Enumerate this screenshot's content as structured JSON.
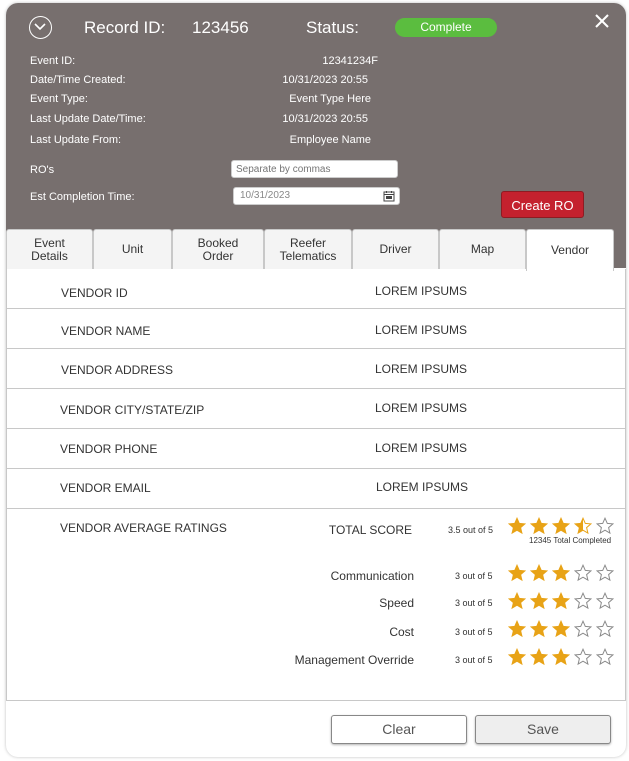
{
  "header": {
    "record_id_label": "Record ID:",
    "record_id_value": "123456",
    "status_label": "Status:",
    "status_value": "Complete",
    "status_color": "#5bbd3f",
    "background_color": "#776f6e"
  },
  "info": {
    "event_id_label": "Event ID:",
    "event_id_value": "12341234F",
    "created_label": "Date/Time Created:",
    "created_value": "10/31/2023 20:55",
    "event_type_label": "Event Type:",
    "event_type_value": "Event Type Here",
    "last_update_label": "Last Update Date/Time:",
    "last_update_value": "10/31/2023 20:55",
    "last_update_from_label": "Last Update From:",
    "last_update_from_value": "Employee Name",
    "ros_label": "RO's",
    "ros_placeholder": "Separate by commas",
    "est_label": "Est Completion Time:",
    "est_value": "10/31/2023",
    "create_ro_label": "Create RO",
    "create_ro_color": "#c4212e"
  },
  "tabs": [
    {
      "label": "Event\nDetails"
    },
    {
      "label": "Unit"
    },
    {
      "label": "Booked\nOrder"
    },
    {
      "label": "Reefer\nTelematics"
    },
    {
      "label": "Driver"
    },
    {
      "label": "Map"
    },
    {
      "label": "Vendor",
      "active": true
    }
  ],
  "vendor": {
    "rows": [
      {
        "label": "VENDOR ID",
        "value": "LOREM IPSUMS"
      },
      {
        "label": "VENDOR NAME",
        "value": "LOREM IPSUMS"
      },
      {
        "label": "VENDOR ADDRESS",
        "value": "LOREM IPSUMS"
      },
      {
        "label": "VENDOR CITY/STATE/ZIP",
        "value": "LOREM IPSUMS"
      },
      {
        "label": "VENDOR PHONE",
        "value": "LOREM IPSUMS"
      },
      {
        "label": "VENDOR EMAIL",
        "value": "LOREM IPSUMS"
      }
    ],
    "ratings_label": "VENDOR AVERAGE RATINGS",
    "total_completed": "12345 Total Completed",
    "star_color": "#e8a317",
    "ratings": [
      {
        "label": "TOTAL SCORE",
        "score_text": "3.5 out of 5",
        "score": 3.5
      },
      {
        "label": "Communication",
        "score_text": "3 out of 5",
        "score": 3
      },
      {
        "label": "Speed",
        "score_text": "3 out of 5",
        "score": 3
      },
      {
        "label": "Cost",
        "score_text": "3 out of 5",
        "score": 3
      },
      {
        "label": "Management Override",
        "score_text": "3 out of 5",
        "score": 3
      }
    ]
  },
  "footer": {
    "clear_label": "Clear",
    "save_label": "Save"
  }
}
